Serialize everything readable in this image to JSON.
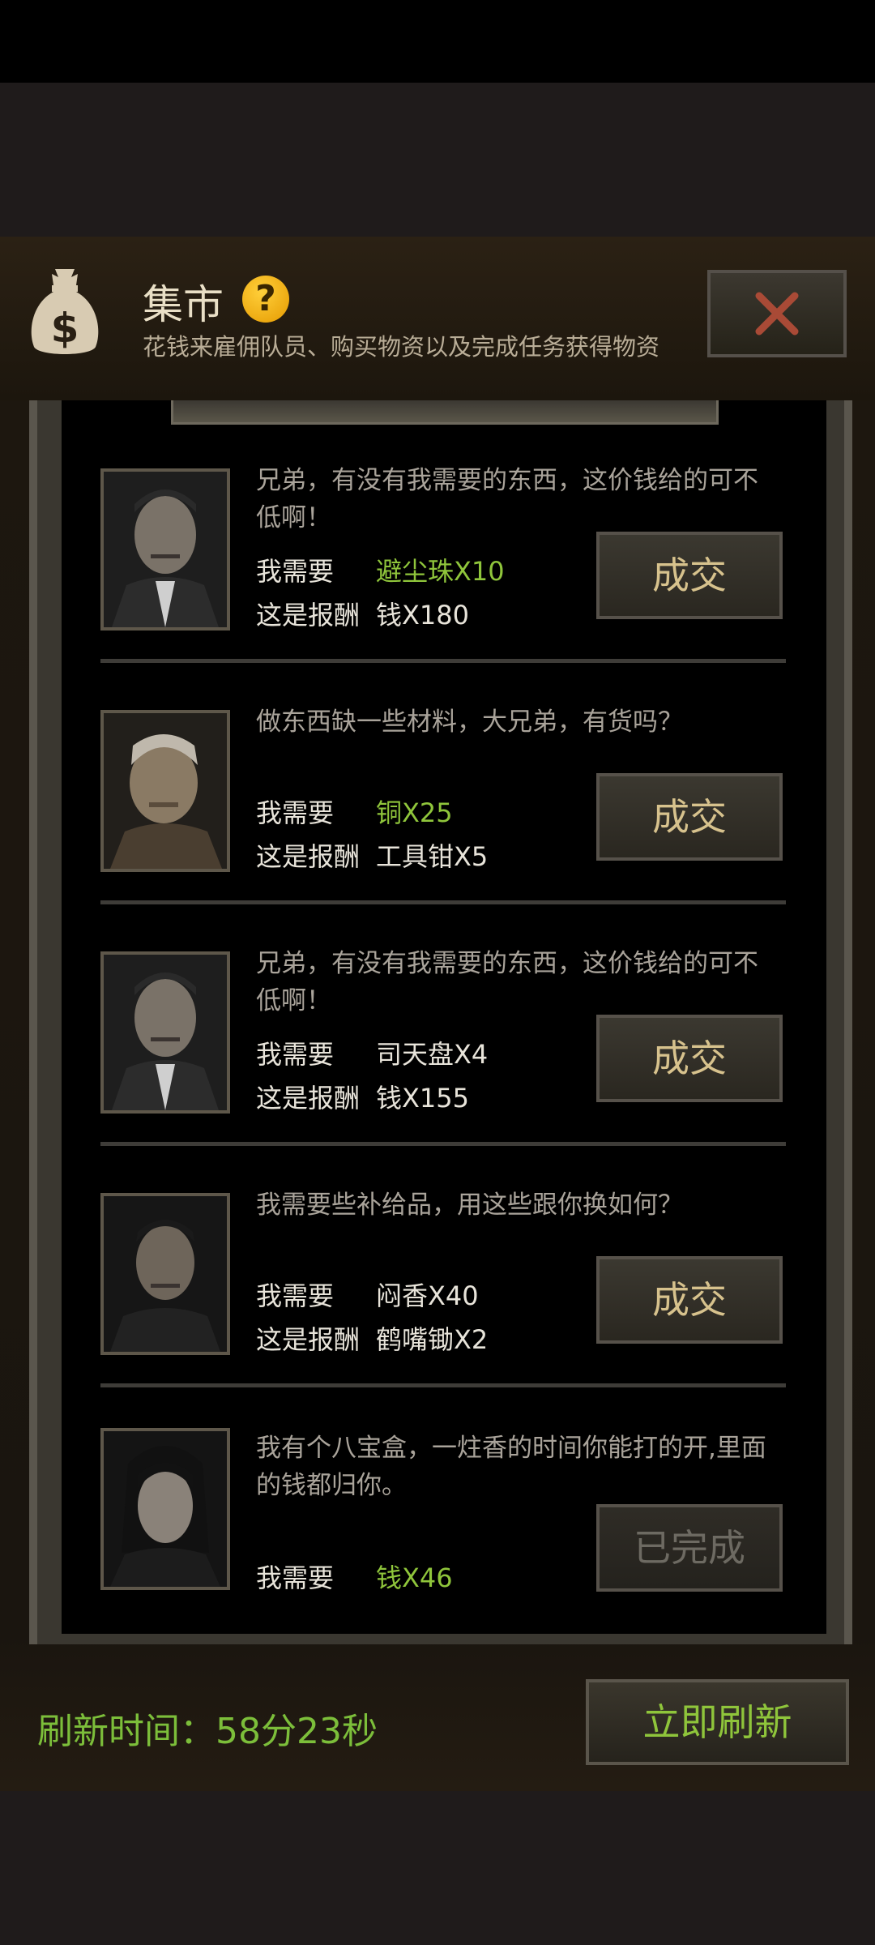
{
  "header": {
    "title": "集市",
    "subtitle": "花钱来雇佣队员、购买物资以及完成任务获得物资",
    "help_symbol": "?",
    "icons": [
      "money-bag-icon",
      "help-icon",
      "close-icon"
    ],
    "close_icon_color": "#a94a36"
  },
  "labels": {
    "need": "我需要",
    "reward": "这是报酬"
  },
  "quests": [
    {
      "dialog": "兄弟，有没有我需要的东西，这价钱给的可不低啊！",
      "need_item": "避尘珠X10",
      "reward_item": "钱X180",
      "button": "成交"
    },
    {
      "dialog": "做东西缺一些材料，大兄弟，有货吗？",
      "need_item": "铜X25",
      "reward_item": "工具钳X5",
      "button": "成交"
    },
    {
      "dialog": "兄弟，有没有我需要的东西，这价钱给的可不低啊！",
      "need_item": "司天盘X4",
      "reward_item": "钱X155",
      "button": "成交"
    },
    {
      "dialog": "我需要些补给品，用这些跟你换如何？",
      "need_item": "闷香X40",
      "reward_item": "鹤嘴锄X2",
      "button": "成交"
    },
    {
      "dialog": "我有个八宝盒，一炷香的时间你能打的开,里面的钱都归你。",
      "need_item": "钱X46",
      "button": "已完成"
    }
  ],
  "footer": {
    "refresh_time_label": "刷新时间：",
    "refresh_time_value": "58分23秒",
    "refresh_button": "立即刷新"
  },
  "colors": {
    "accent_green": "#8fc53b",
    "button_text": "#d7c28d",
    "panel_dark": "#1c160d"
  }
}
